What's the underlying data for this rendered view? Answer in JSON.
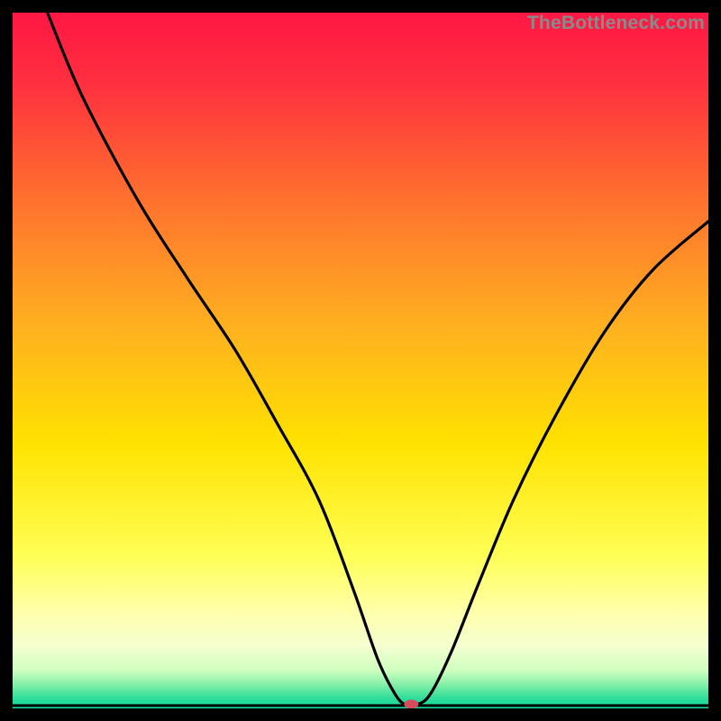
{
  "watermark": "TheBottleneck.com",
  "chart_data": {
    "type": "line",
    "title": "",
    "xlabel": "",
    "ylabel": "",
    "xlim": [
      0,
      100
    ],
    "ylim": [
      0,
      100
    ],
    "grid": false,
    "legend": false,
    "gradient_stops": [
      {
        "offset": 0.0,
        "color": "#ff1744"
      },
      {
        "offset": 0.1,
        "color": "#ff2f3f"
      },
      {
        "offset": 0.25,
        "color": "#ff6a30"
      },
      {
        "offset": 0.45,
        "color": "#ffb020"
      },
      {
        "offset": 0.62,
        "color": "#ffe200"
      },
      {
        "offset": 0.78,
        "color": "#ffff55"
      },
      {
        "offset": 0.86,
        "color": "#ffffaa"
      },
      {
        "offset": 0.91,
        "color": "#f5ffd0"
      },
      {
        "offset": 0.945,
        "color": "#d0ffc0"
      },
      {
        "offset": 0.965,
        "color": "#88f0a8"
      },
      {
        "offset": 0.985,
        "color": "#30dd99"
      },
      {
        "offset": 1.0,
        "color": "#10d8a0"
      }
    ],
    "series": [
      {
        "name": "bottleneck-curve",
        "x": [
          5,
          10,
          18,
          25,
          32,
          38,
          44,
          49,
          52.5,
          55,
          56.5,
          58,
          60,
          63,
          67,
          72,
          78,
          85,
          92,
          100
        ],
        "values": [
          100,
          88,
          73,
          62,
          51.5,
          41,
          30,
          17,
          7,
          2,
          0.5,
          0.5,
          2,
          8,
          18,
          30,
          42,
          54,
          63,
          70
        ]
      }
    ],
    "marker": {
      "x": 57.3,
      "y": 0.6,
      "color": "#d94a5a",
      "rx": 8,
      "ry": 5
    },
    "baseline": {
      "y": 0.4,
      "x_start": 0,
      "x_end": 100
    }
  }
}
